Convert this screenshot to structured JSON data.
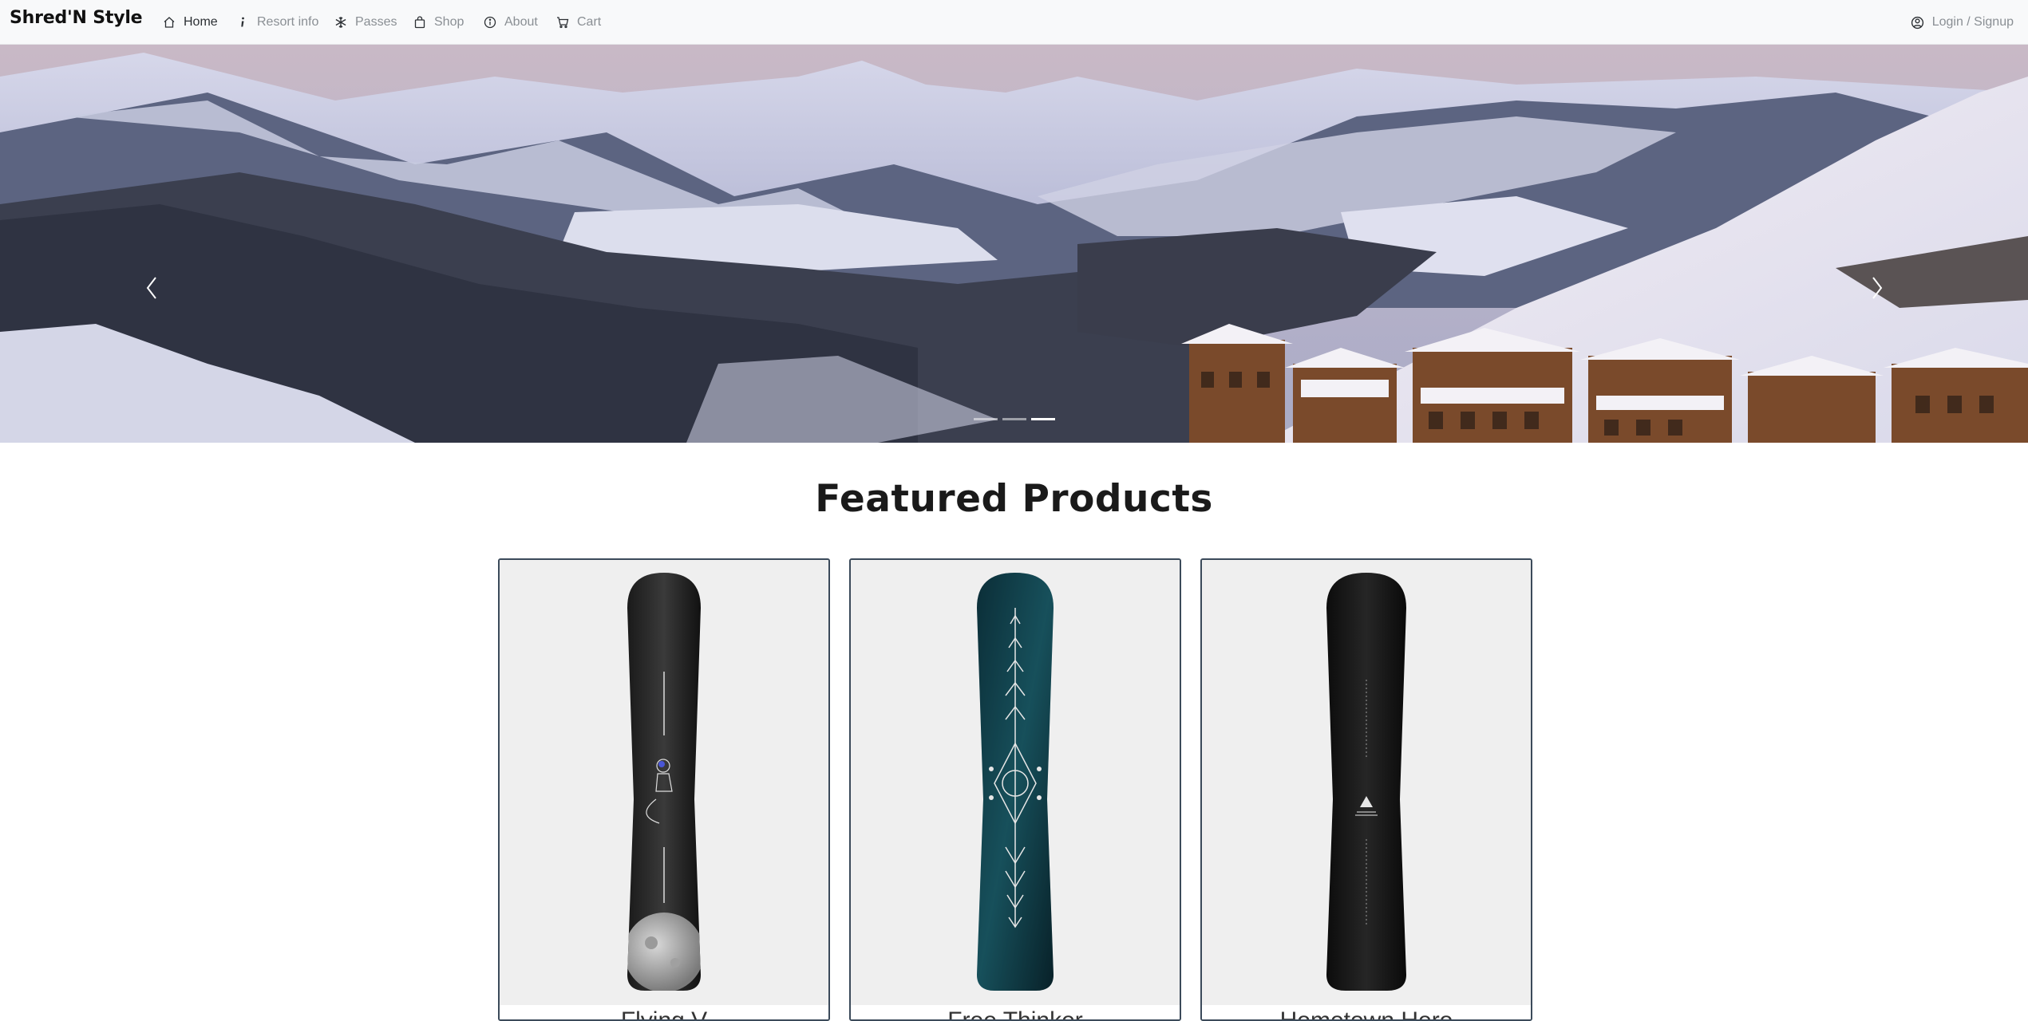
{
  "navbar": {
    "brand": "Shred'N Style",
    "items": [
      {
        "label": "Home",
        "icon": "house-icon",
        "active": true
      },
      {
        "label": "Resort info",
        "icon": "info-icon",
        "active": false
      },
      {
        "label": "Passes",
        "icon": "snowflake-icon",
        "active": false
      },
      {
        "label": "Shop",
        "icon": "bag-icon",
        "active": false
      },
      {
        "label": "About",
        "icon": "info-circle-icon",
        "active": false
      },
      {
        "label": "Cart",
        "icon": "cart-icon",
        "active": false
      }
    ],
    "login_label": "Login / Signup",
    "login_icon": "person-circle-icon"
  },
  "hero": {
    "slide_count": 3,
    "active_slide": 3,
    "prev_icon": "chevron-left-icon",
    "next_icon": "chevron-right-icon"
  },
  "featured": {
    "title": "Featured Products",
    "products": [
      {
        "name": "Flying V",
        "image": "snowboard-astronaut-moon"
      },
      {
        "name": "Free Thinker",
        "image": "snowboard-teal-mandala"
      },
      {
        "name": "Hometown Hero",
        "image": "snowboard-black-triangle"
      }
    ]
  },
  "colors": {
    "navbar_bg": "#f8f9fa",
    "card_border": "#3b4a5a",
    "card_bg": "#f0f0f0"
  }
}
